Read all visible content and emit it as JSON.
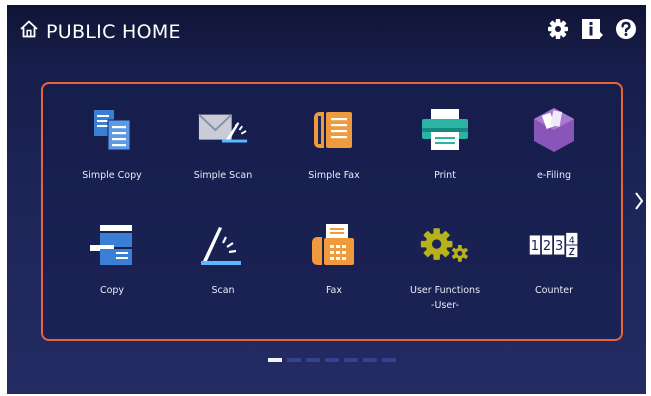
{
  "header": {
    "title": "PUBLIC HOME",
    "icons": [
      "home-icon",
      "gear-icon",
      "info-icon",
      "help-icon"
    ]
  },
  "tiles": [
    {
      "label": "Simple Copy",
      "icon": "simple-copy-icon"
    },
    {
      "label": "Simple Scan",
      "icon": "simple-scan-icon"
    },
    {
      "label": "Simple Fax",
      "icon": "simple-fax-icon"
    },
    {
      "label": "Print",
      "icon": "print-icon"
    },
    {
      "label": "e-Filing",
      "icon": "e-filing-icon"
    },
    {
      "label": "Copy",
      "icon": "copy-icon"
    },
    {
      "label": "Scan",
      "icon": "scan-icon"
    },
    {
      "label": "Fax",
      "icon": "fax-icon"
    },
    {
      "label": "User Functions",
      "sublabel": "-User-",
      "icon": "user-functions-icon"
    },
    {
      "label": "Counter",
      "icon": "counter-icon",
      "digits": [
        "1",
        "2",
        "3",
        "4"
      ]
    }
  ],
  "pagination": {
    "pages": 7,
    "current": 1
  },
  "colors": {
    "accent_border": "#e8643a",
    "background": "#1c2457",
    "copy_blue": "#3a7fd6",
    "fax_orange": "#ef9a3c",
    "print_teal": "#2bb3a3",
    "efiling_purple": "#8a55b8",
    "user_functions_olive": "#b7b21c"
  }
}
